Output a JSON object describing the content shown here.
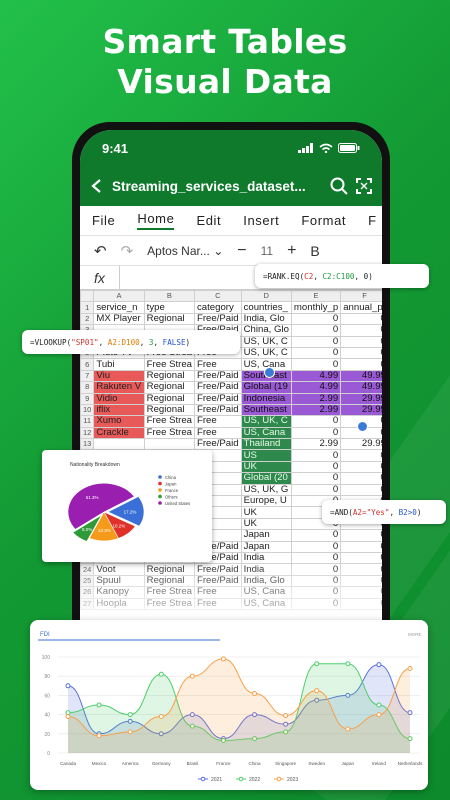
{
  "headline": {
    "line1": "Smart Tables",
    "line2": "Visual Data"
  },
  "status": {
    "time": "9:41"
  },
  "appbar": {
    "title": "Streaming_services_dataset..."
  },
  "menu": [
    "File",
    "Home",
    "Edit",
    "Insert",
    "Format",
    "F"
  ],
  "toolbar": {
    "font": "Aptos Nar...",
    "size": "11",
    "bold": "B"
  },
  "fx_label": "fx",
  "columns": [
    "A",
    "B",
    "C",
    "D",
    "E",
    "F"
  ],
  "rows": [
    {
      "n": "1",
      "a": "service_n",
      "b": "type",
      "c": "category",
      "d": "countries_",
      "e": "monthly_p",
      "f": "annual_pr"
    },
    {
      "n": "2",
      "a": "MX Player",
      "b": "Regional",
      "c": "Free/Paid",
      "d": "India, Glo",
      "e": "0",
      "f": "0"
    },
    {
      "n": "3",
      "a": "",
      "b": "",
      "c": "Free/Paid",
      "d": "China, Glo",
      "e": "0",
      "f": "0"
    },
    {
      "n": "4",
      "a": "",
      "b": "Free Strea",
      "c": "Free",
      "d": "US, UK, C",
      "e": "0",
      "f": "0"
    },
    {
      "n": "5",
      "a": "Pluto TV",
      "b": "Free Strea",
      "c": "Free",
      "d": "US, UK, C",
      "e": "0",
      "f": "0"
    },
    {
      "n": "6",
      "a": "Tubi",
      "b": "Free Strea",
      "c": "Free",
      "d": "US, Cana",
      "e": "0",
      "f": "0"
    },
    {
      "n": "7",
      "a": "Viu",
      "b": "Regional",
      "c": "Free/Paid",
      "d": "Southeast",
      "e": "4.99",
      "f": "49.99"
    },
    {
      "n": "8",
      "a": "Rakuten V",
      "b": "Regional",
      "c": "Free/Paid",
      "d": "Global (19",
      "e": "4.99",
      "f": "49.99"
    },
    {
      "n": "9",
      "a": "Vidio",
      "b": "Regional",
      "c": "Free/Paid",
      "d": "Indonesia",
      "e": "2.99",
      "f": "29.99"
    },
    {
      "n": "10",
      "a": "iflix",
      "b": "Regional",
      "c": "Free/Paid",
      "d": "Southeast",
      "e": "2.99",
      "f": "29.99"
    },
    {
      "n": "11",
      "a": "Xumo",
      "b": "Free Strea",
      "c": "Free",
      "d": "US, UK, C",
      "e": "0",
      "f": "0"
    },
    {
      "n": "12",
      "a": "Crackle",
      "b": "Free Strea",
      "c": "Free",
      "d": "US, Cana",
      "e": "0",
      "f": "0"
    },
    {
      "n": "13",
      "a": "",
      "b": "",
      "c": "Free/Paid",
      "d": "Thailand",
      "e": "2.99",
      "f": "29.99"
    },
    {
      "n": "14",
      "a": "",
      "b": "",
      "c": "",
      "d": "US",
      "e": "0",
      "f": "0"
    },
    {
      "n": "15",
      "a": "",
      "b": "",
      "c": "",
      "d": "UK",
      "e": "0",
      "f": "0"
    },
    {
      "n": "16",
      "a": "",
      "b": "",
      "c": "",
      "d": "Global (20",
      "e": "0",
      "f": "0"
    },
    {
      "n": "17",
      "a": "",
      "b": "",
      "c": "",
      "d": "US, UK, G",
      "e": "0",
      "f": "0"
    },
    {
      "n": "18",
      "a": "",
      "b": "",
      "c": "",
      "d": "Europe, U",
      "e": "0",
      "f": "0"
    },
    {
      "n": "19",
      "a": "",
      "b": "",
      "c": "",
      "d": "UK",
      "e": "0",
      "f": "0"
    },
    {
      "n": "20",
      "a": "",
      "b": "",
      "c": "",
      "d": "UK",
      "e": "0",
      "f": "0"
    },
    {
      "n": "21",
      "a": "",
      "b": "",
      "c": "",
      "d": "Japan",
      "e": "0",
      "f": "0"
    },
    {
      "n": "22",
      "a": "",
      "b": "",
      "c": "Free/Paid",
      "d": "Japan",
      "e": "0",
      "f": "0"
    },
    {
      "n": "23",
      "a": "JioCinema",
      "b": "Regional",
      "c": "Free/Paid",
      "d": "India",
      "e": "0",
      "f": "0"
    },
    {
      "n": "24",
      "a": "Voot",
      "b": "Regional",
      "c": "Free/Paid",
      "d": "India",
      "e": "0",
      "f": "0"
    },
    {
      "n": "25",
      "a": "Spuul",
      "b": "Regional",
      "c": "Free/Paid",
      "d": "India, Glo",
      "e": "0",
      "f": "0"
    },
    {
      "n": "26",
      "a": "Kanopy",
      "b": "Free Strea",
      "c": "Free",
      "d": "US, Cana",
      "e": "0",
      "f": "0"
    },
    {
      "n": "27",
      "a": "Hoopla",
      "b": "Free Strea",
      "c": "Free",
      "d": "US, Cana",
      "e": "0",
      "f": "0"
    }
  ],
  "formulas": {
    "rank": "=RANK.EQ(C2, C2:C100, 0)",
    "vlookup": "=VLOOKUP(\"SP01\", A2:D100, 3, FALSE)",
    "and": "=AND(A2=\"Yes\", B2>0)"
  },
  "pie": {
    "title": "Nationality Breakdown",
    "legend": [
      "China",
      "Japan",
      "France",
      "Others",
      "United States"
    ],
    "colors": [
      "#3a6fd8",
      "#e0302a",
      "#f59a1a",
      "#2f9a3a",
      "#9a1fb0"
    ],
    "values": [
      17.2,
      10.2,
      13.3,
      8.0,
      51.3
    ],
    "labels": [
      "17.2%",
      "10.2%",
      "13.3%",
      "8.0%",
      "51.3%"
    ]
  },
  "chart_data": {
    "type": "line",
    "tab": "FDI",
    "corner_label": "MORE",
    "categories": [
      "Canada",
      "Mexico",
      "America",
      "Germany",
      "Brasil",
      "France",
      "China",
      "Singapore",
      "Sweden",
      "Japan",
      "Ireland",
      "Netherlands"
    ],
    "ylim": [
      0,
      100
    ],
    "yticks": [
      "0",
      "20",
      "40",
      "60",
      "80",
      "100"
    ],
    "series": [
      {
        "name": "2021",
        "color": "#5a6fe0",
        "values": [
          70,
          20,
          33,
          20,
          40,
          15,
          40,
          30,
          55,
          60,
          92,
          42
        ]
      },
      {
        "name": "2022",
        "color": "#4ccf6a",
        "values": [
          42,
          50,
          40,
          82,
          28,
          13,
          15,
          22,
          93,
          93,
          50,
          15
        ]
      },
      {
        "name": "2023",
        "color": "#f5a04a",
        "values": [
          38,
          18,
          22,
          38,
          80,
          98,
          62,
          39,
          65,
          25,
          40,
          88
        ]
      }
    ]
  }
}
